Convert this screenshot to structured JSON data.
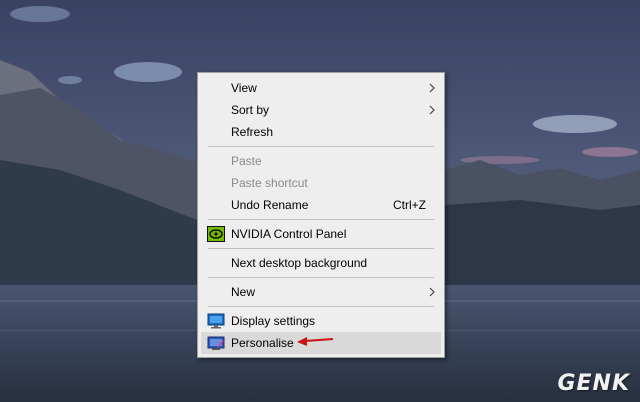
{
  "menu": {
    "items": [
      {
        "label": "View",
        "submenu": true
      },
      {
        "label": "Sort by",
        "submenu": true
      },
      {
        "label": "Refresh"
      },
      {
        "label": "Paste",
        "disabled": true
      },
      {
        "label": "Paste shortcut",
        "disabled": true
      },
      {
        "label": "Undo Rename",
        "shortcut": "Ctrl+Z"
      },
      {
        "label": "NVIDIA Control Panel",
        "icon": "nvidia-icon"
      },
      {
        "label": "Next desktop background"
      },
      {
        "label": "New",
        "submenu": true
      },
      {
        "label": "Display settings",
        "icon": "display-icon"
      },
      {
        "label": "Personalise",
        "icon": "personalise-icon",
        "highlighted": true
      }
    ]
  },
  "watermark": "GENK",
  "colors": {
    "menu_bg": "#eeeeee",
    "highlight": "#d9d9d9",
    "disabled_text": "#8a8a8a",
    "annotation_arrow": "#cc1111",
    "nvidia_green": "#76b900"
  }
}
